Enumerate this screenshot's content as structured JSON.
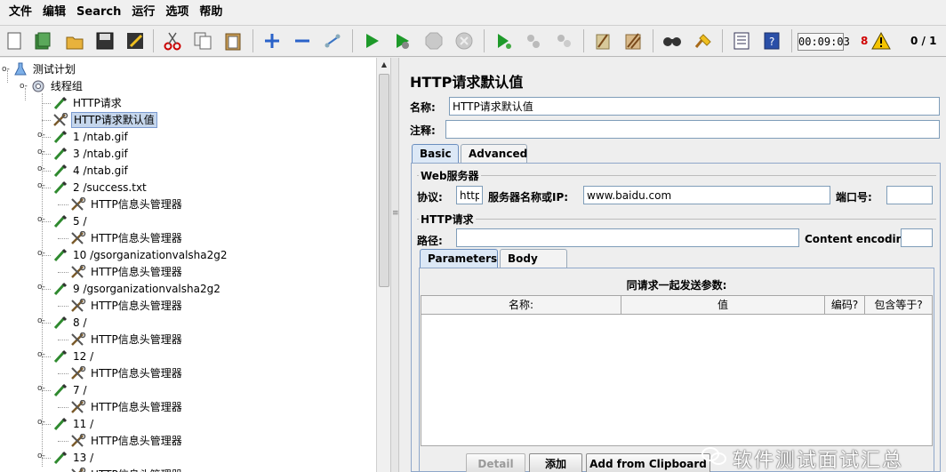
{
  "menu": [
    "文件",
    "编辑",
    "Search",
    "运行",
    "选项",
    "帮助"
  ],
  "toolbar": {
    "icons": [
      "new-icon",
      "templates-icon",
      "open-icon",
      "save-icon",
      "save-as-icon",
      "cut-icon",
      "copy-icon",
      "paste-icon",
      "expand-icon",
      "collapse-icon",
      "toggle-icon",
      "start-icon",
      "start-no-pause-icon",
      "stop-icon",
      "shutdown-icon",
      "remote-start-icon",
      "remote-stop-icon",
      "remote-shutdown-icon",
      "clear-icon",
      "clear-all-icon",
      "search-icon",
      "reset-search-icon",
      "function-helper-icon",
      "help-icon"
    ],
    "elapsed_time": "00:09:03",
    "error_count": "8",
    "active_threads": "0 / 1"
  },
  "tree": {
    "root": "测试计划",
    "thread_group": "线程组",
    "nodes": [
      {
        "label": "HTTP请求"
      },
      {
        "label": "HTTP请求默认值",
        "selected": true
      },
      {
        "label": "1 /ntab.gif"
      },
      {
        "label": "3 /ntab.gif"
      },
      {
        "label": "4 /ntab.gif"
      },
      {
        "label": "2 /success.txt"
      },
      {
        "label": "HTTP信息头管理器"
      },
      {
        "label": "5 /"
      },
      {
        "label": "HTTP信息头管理器"
      },
      {
        "label": "10 /gsorganizationvalsha2g2"
      },
      {
        "label": "HTTP信息头管理器"
      },
      {
        "label": "9 /gsorganizationvalsha2g2"
      },
      {
        "label": "HTTP信息头管理器"
      },
      {
        "label": "8 /"
      },
      {
        "label": "HTTP信息头管理器"
      },
      {
        "label": "12 /"
      },
      {
        "label": "HTTP信息头管理器"
      },
      {
        "label": "7 /"
      },
      {
        "label": "HTTP信息头管理器"
      },
      {
        "label": "11 /"
      },
      {
        "label": "HTTP信息头管理器"
      },
      {
        "label": "13 /"
      },
      {
        "label": "HTTP信息头管理器"
      }
    ]
  },
  "panel": {
    "title": "HTTP请求默认值",
    "name_label": "名称:",
    "name_value": "HTTP请求默认值",
    "comment_label": "注释:",
    "comment_value": "",
    "tabs": [
      "Basic",
      "Advanced"
    ],
    "web_server": {
      "title": "Web服务器",
      "protocol_label": "协议:",
      "protocol_value": "http",
      "server_label": "服务器名称或IP:",
      "server_value": "www.baidu.com",
      "port_label": "端口号:",
      "port_value": ""
    },
    "http_request": {
      "title": "HTTP请求",
      "path_label": "路径:",
      "path_value": "",
      "encoding_label": "Content encoding:",
      "encoding_value": ""
    },
    "param_tabs": [
      "Parameters",
      "Body Data"
    ],
    "params_caption": "同请求一起发送参数:",
    "columns": [
      "名称:",
      "值",
      "编码?",
      "包含等于?"
    ],
    "buttons": [
      "Detail",
      "添加",
      "Add from Clipboard"
    ]
  },
  "watermark": "软件测试面试汇总"
}
